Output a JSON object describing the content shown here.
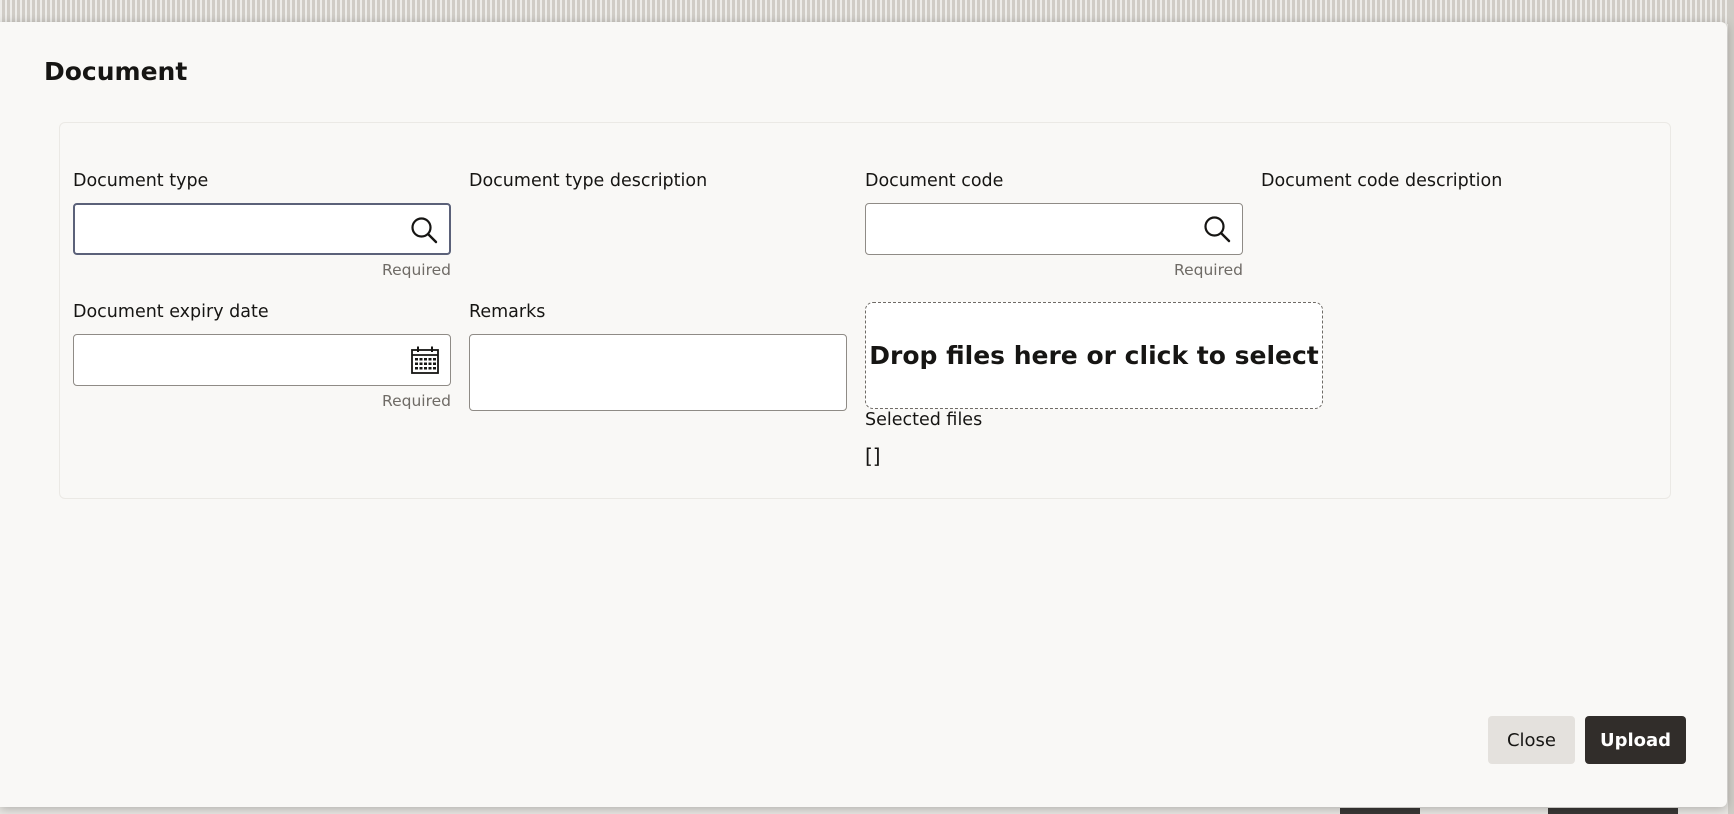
{
  "dialog": {
    "title": "Document"
  },
  "form": {
    "document_type": {
      "label": "Document type",
      "value": "",
      "helper": "Required",
      "icon": "search-icon"
    },
    "document_type_description": {
      "label": "Document type description",
      "value": ""
    },
    "document_code": {
      "label": "Document code",
      "value": "",
      "helper": "Required",
      "icon": "search-icon"
    },
    "document_code_description": {
      "label": "Document code description",
      "value": ""
    },
    "document_expiry_date": {
      "label": "Document expiry date",
      "value": "",
      "helper": "Required",
      "icon": "calendar-icon"
    },
    "remarks": {
      "label": "Remarks",
      "value": ""
    },
    "file_picker": {
      "prompt": "Drop files here or click to select",
      "selected_label": "Selected files",
      "selected_value": "[]"
    }
  },
  "footer": {
    "close_label": "Close",
    "upload_label": "Upload"
  },
  "colors": {
    "primary_button": "#312d2a",
    "secondary_button": "#e4e1dd",
    "focus_border": "#5b6179",
    "background": "#f9f8f6"
  }
}
